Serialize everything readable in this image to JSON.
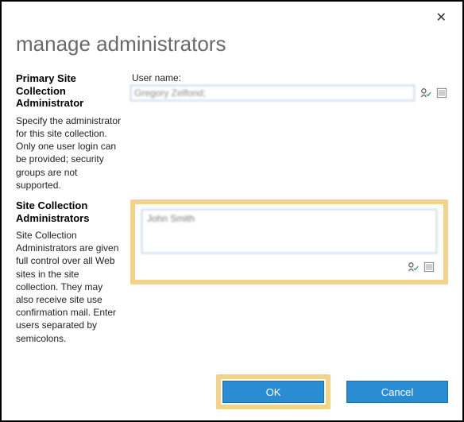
{
  "dialog": {
    "title": "manage administrators"
  },
  "primary": {
    "heading": "Primary Site Collection Administrator",
    "description": "Specify the administrator for this site collection. Only one user login can be provided; security groups are not supported.",
    "field_label": "User name:",
    "value_display": "Gregory Zelfond;"
  },
  "secondary": {
    "heading": "Site Collection Administrators",
    "description": "Site Collection Administrators are given full control over all Web sites in the site collection. They may also receive site use confirmation mail. Enter users separated by semicolons.",
    "value_display": "John Smith"
  },
  "buttons": {
    "ok": "OK",
    "cancel": "Cancel"
  },
  "icons": {
    "check_names": "check-names-icon",
    "browse": "browse-icon",
    "close": "✕"
  }
}
